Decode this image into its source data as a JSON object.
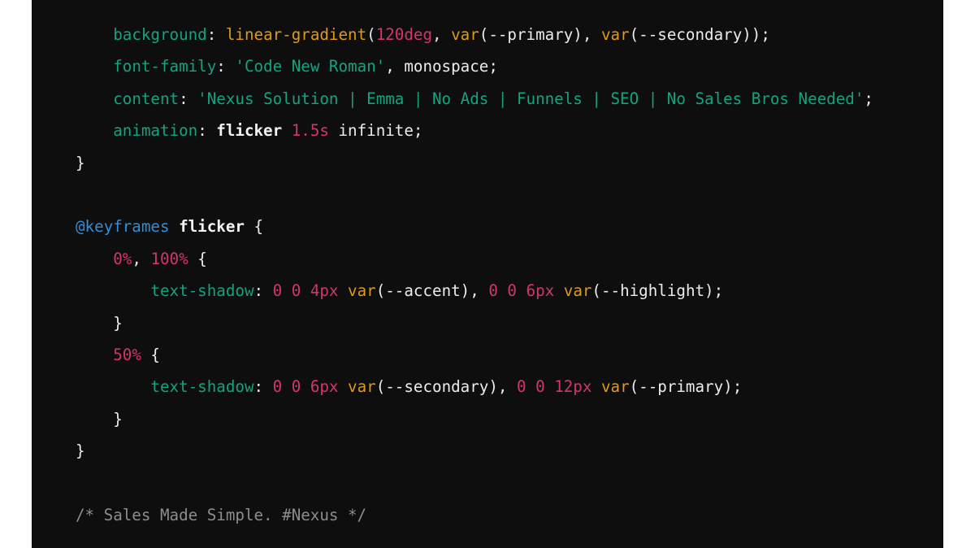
{
  "code_block": {
    "language": "css",
    "colors": {
      "background": "#0e0e0e",
      "property": "#12a37f",
      "function": "#df9a17",
      "number": "#d3356c",
      "string": "#12a37f",
      "at_rule": "#2f8fd8",
      "plain": "#ececec",
      "comment": "#8d8d8d"
    },
    "lines": [
      {
        "indent": "    ",
        "tokens": [
          {
            "type": "prop",
            "text": "background"
          },
          {
            "type": "punct",
            "text": ": "
          },
          {
            "type": "fn",
            "text": "linear-gradient"
          },
          {
            "type": "punct",
            "text": "("
          },
          {
            "type": "num",
            "text": "120deg"
          },
          {
            "type": "punct",
            "text": ", "
          },
          {
            "type": "fn",
            "text": "var"
          },
          {
            "type": "plain",
            "text": "(--primary), "
          },
          {
            "type": "fn",
            "text": "var"
          },
          {
            "type": "plain",
            "text": "(--secondary));"
          }
        ]
      },
      {
        "indent": "    ",
        "tokens": [
          {
            "type": "prop",
            "text": "font-family"
          },
          {
            "type": "punct",
            "text": ": "
          },
          {
            "type": "str",
            "text": "'Code New Roman'"
          },
          {
            "type": "plain",
            "text": ", monospace;"
          }
        ]
      },
      {
        "indent": "    ",
        "tokens": [
          {
            "type": "prop",
            "text": "content"
          },
          {
            "type": "punct",
            "text": ": "
          },
          {
            "type": "str",
            "text": "'Nexus Solution | Emma | No Ads | Funnels | SEO | No Sales Bros Needed'"
          },
          {
            "type": "plain",
            "text": ";"
          }
        ]
      },
      {
        "indent": "    ",
        "tokens": [
          {
            "type": "prop",
            "text": "animation"
          },
          {
            "type": "punct",
            "text": ": "
          },
          {
            "type": "bold",
            "text": "flicker "
          },
          {
            "type": "num",
            "text": "1.5s"
          },
          {
            "type": "plain",
            "text": " infinite;"
          }
        ]
      },
      {
        "indent": "",
        "tokens": [
          {
            "type": "plain",
            "text": "}"
          }
        ]
      },
      {
        "indent": "",
        "tokens": []
      },
      {
        "indent": "",
        "tokens": [
          {
            "type": "at",
            "text": "@keyframes"
          },
          {
            "type": "bold",
            "text": " flicker "
          },
          {
            "type": "plain",
            "text": "{"
          }
        ]
      },
      {
        "indent": "    ",
        "tokens": [
          {
            "type": "num",
            "text": "0%"
          },
          {
            "type": "plain",
            "text": ", "
          },
          {
            "type": "num",
            "text": "100%"
          },
          {
            "type": "plain",
            "text": " {"
          }
        ]
      },
      {
        "indent": "        ",
        "tokens": [
          {
            "type": "prop",
            "text": "text-shadow"
          },
          {
            "type": "punct",
            "text": ": "
          },
          {
            "type": "num",
            "text": "0 0 4px"
          },
          {
            "type": "plain",
            "text": " "
          },
          {
            "type": "fn",
            "text": "var"
          },
          {
            "type": "plain",
            "text": "(--accent), "
          },
          {
            "type": "num",
            "text": "0 0 6px"
          },
          {
            "type": "plain",
            "text": " "
          },
          {
            "type": "fn",
            "text": "var"
          },
          {
            "type": "plain",
            "text": "(--highlight);"
          }
        ]
      },
      {
        "indent": "    ",
        "tokens": [
          {
            "type": "plain",
            "text": "}"
          }
        ]
      },
      {
        "indent": "    ",
        "tokens": [
          {
            "type": "num",
            "text": "50%"
          },
          {
            "type": "plain",
            "text": " {"
          }
        ]
      },
      {
        "indent": "        ",
        "tokens": [
          {
            "type": "prop",
            "text": "text-shadow"
          },
          {
            "type": "punct",
            "text": ": "
          },
          {
            "type": "num",
            "text": "0 0 6px"
          },
          {
            "type": "plain",
            "text": " "
          },
          {
            "type": "fn",
            "text": "var"
          },
          {
            "type": "plain",
            "text": "(--secondary), "
          },
          {
            "type": "num",
            "text": "0 0 12px"
          },
          {
            "type": "plain",
            "text": " "
          },
          {
            "type": "fn",
            "text": "var"
          },
          {
            "type": "plain",
            "text": "(--primary);"
          }
        ]
      },
      {
        "indent": "    ",
        "tokens": [
          {
            "type": "plain",
            "text": "}"
          }
        ]
      },
      {
        "indent": "",
        "tokens": [
          {
            "type": "plain",
            "text": "}"
          }
        ]
      },
      {
        "indent": "",
        "tokens": []
      },
      {
        "indent": "",
        "tokens": [
          {
            "type": "comment",
            "text": "/* Sales Made Simple. #Nexus */"
          }
        ]
      }
    ]
  }
}
